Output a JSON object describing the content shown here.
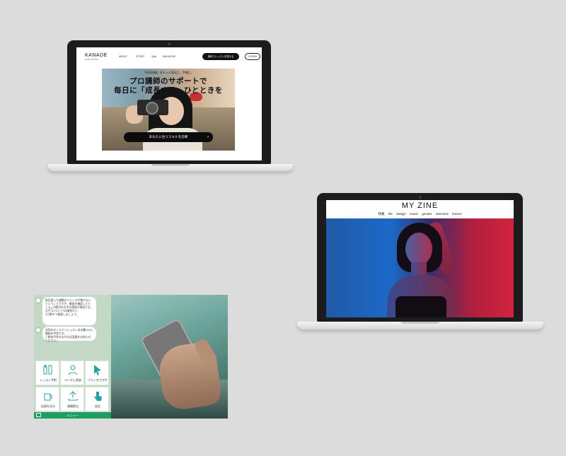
{
  "kanade": {
    "logo": "KANADE",
    "logo_sub": "MUSIC SCHOOL",
    "nav": [
      "ABOUT",
      "STORE",
      "Q&A",
      "MAGAZINE"
    ],
    "trial_button": "無料でレッスンを受ける",
    "login_button": "LOGIN",
    "tagline": "「成長体験」をもっと身近に、手軽に。",
    "headline_1": "プロ講師のサポートで",
    "headline_2": "毎日に「成長する」ひとときを",
    "cta": "あなたに合うスキルを診断",
    "cta_arrow": "›"
  },
  "zine": {
    "title": "MY ZINE",
    "nav": [
      "特集",
      "life",
      "design",
      "music",
      "gender",
      "interview",
      "lesson"
    ]
  },
  "chat_app": {
    "messages": [
      "前回習った課題のフレーズが弾けないということですが、動画を確認したところ△小節目の左手の運指が原因です。\n左手ストロークの練習から\n2小節ずつ復習しましょう。",
      "次回のオンラインレッスンは水曜14:00開始の予定です。\nご都合が合わなければ変更をお知らせください。"
    ],
    "grid": [
      {
        "label": "レッスン予約",
        "icon": "piano-icon"
      },
      {
        "label": "コーチに相談",
        "icon": "coach-icon"
      },
      {
        "label": "プランをさがす",
        "icon": "cursor-icon"
      },
      {
        "label": "記録を見る",
        "icon": "cup-icon"
      },
      {
        "label": "課題提出",
        "icon": "upload-icon"
      },
      {
        "label": "設定",
        "icon": "hand-pointer-icon"
      }
    ],
    "menu_label": "メニュー",
    "accent": "#1f9e64"
  }
}
